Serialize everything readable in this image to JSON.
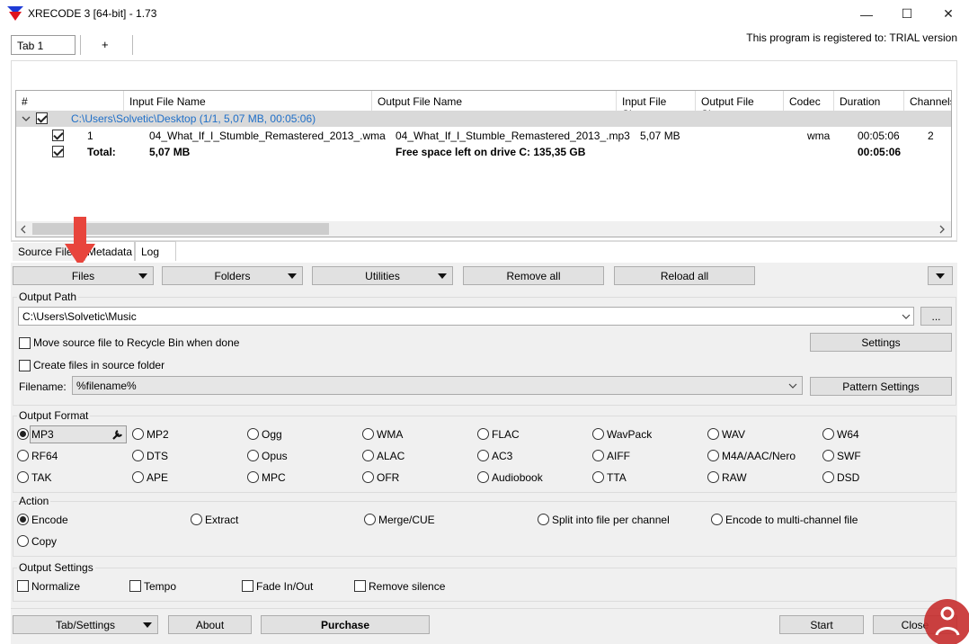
{
  "window": {
    "title": "XRECODE 3 [64-bit] - 1.73",
    "minimize": "—",
    "maximize": "☐",
    "close": "✕"
  },
  "tabs": [
    {
      "label": "Tab 1"
    },
    {
      "label": "+"
    }
  ],
  "registered": "This program is registered to: TRIAL version",
  "list": {
    "columns": [
      "#",
      "Input File Name",
      "Output File Name",
      "Input File Size",
      "Output File Size",
      "Codec",
      "Duration",
      "Channels"
    ],
    "group": "C:\\Users\\Solvetic\\Desktop (1/1, 5,07 MB, 00:05:06)",
    "row": {
      "num": "1",
      "input": "04_What_If_I_Stumble_Remastered_2013_.wma",
      "output": "04_What_If_I_Stumble_Remastered_2013_.mp3",
      "insize": "5,07 MB",
      "codec": "wma",
      "duration": "00:05:06",
      "channels": "2"
    },
    "total": {
      "label": "Total:",
      "size": "5,07 MB",
      "free": "Free space left on drive C: 135,35 GB",
      "duration": "00:05:06"
    }
  },
  "subtabs": [
    "Source Files",
    "Metadata",
    "Log"
  ],
  "toolbar": {
    "files": "Files",
    "folders": "Folders",
    "utilities": "Utilities",
    "remove_all": "Remove all",
    "reload_all": "Reload all"
  },
  "output_path": {
    "title": "Output Path",
    "path": "C:\\Users\\Solvetic\\Music",
    "browse": "...",
    "move_source": "Move source file to Recycle Bin when done",
    "settings": "Settings",
    "create_in_source": "Create files in source folder",
    "filename_label": "Filename:",
    "filename_value": "%filename%",
    "pattern_settings": "Pattern Settings"
  },
  "output_format": {
    "title": "Output Format",
    "row1": [
      "MP3",
      "MP2",
      "Ogg",
      "WMA",
      "FLAC",
      "WavPack",
      "WAV",
      "W64"
    ],
    "row2": [
      "RF64",
      "DTS",
      "Opus",
      "ALAC",
      "AC3",
      "AIFF",
      "M4A/AAC/Nero",
      "SWF"
    ],
    "row3": [
      "TAK",
      "APE",
      "MPC",
      "OFR",
      "Audiobook",
      "TTA",
      "RAW",
      "DSD"
    ],
    "selected": "MP3"
  },
  "action": {
    "title": "Action",
    "options": [
      "Encode",
      "Extract",
      "Merge/CUE",
      "Split into file per channel",
      "Encode to multi-channel file"
    ],
    "copy": "Copy"
  },
  "output_settings": {
    "title": "Output Settings",
    "options": [
      "Normalize",
      "Tempo",
      "Fade In/Out",
      "Remove silence"
    ]
  },
  "bottom": {
    "tab_settings": "Tab/Settings",
    "about": "About",
    "purchase": "Purchase",
    "start": "Start",
    "close": "Close"
  }
}
